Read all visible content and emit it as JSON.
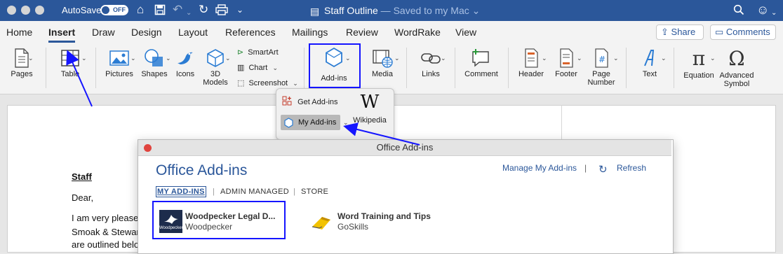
{
  "titlebar": {
    "autosave_label": "AutoSave",
    "autosave_state": "OFF",
    "document_name": "Staff Outline",
    "save_status": " — Saved to my Mac ⌄"
  },
  "tabs": [
    "Home",
    "Insert",
    "Draw",
    "Design",
    "Layout",
    "References",
    "Mailings",
    "Review",
    "WordRake",
    "View"
  ],
  "active_tab": "Insert",
  "share_label": "Share",
  "comments_label": "Comments",
  "ribbon": {
    "pages": "Pages",
    "table": "Table",
    "pictures": "Pictures",
    "shapes": "Shapes",
    "icons": "Icons",
    "models_line1": "3D",
    "models_line2": "Models",
    "smartart": "SmartArt",
    "chart": "Chart",
    "screenshot": "Screenshot",
    "addins": "Add-ins",
    "media": "Media",
    "links": "Links",
    "comment": "Comment",
    "header": "Header",
    "footer": "Footer",
    "page_number_line1": "Page",
    "page_number_line2": "Number",
    "text": "Text",
    "equation": "Equation",
    "advanced_line1": "Advanced",
    "advanced_line2": "Symbol"
  },
  "addins_menu": {
    "get_addins": "Get Add-ins",
    "my_addins": "My Add-ins",
    "wikipedia": "Wikipedia",
    "wikipedia_logo": "W"
  },
  "document": {
    "heading": "Staff",
    "salutation": "Dear,",
    "line1": "I am very please",
    "line2": "Smoak & Stewar",
    "line3": "are outlined belo"
  },
  "dialog": {
    "window_title": "Office Add-ins",
    "heading": "Office Add-ins",
    "manage_link": "Manage My Add-ins",
    "separator": "|",
    "refresh": "Refresh",
    "filters": [
      "MY ADD-INS",
      "ADMIN MANAGED",
      "STORE"
    ],
    "addins": [
      {
        "name": "Woodpecker Legal D...",
        "publisher": "Woodpecker",
        "logo_text": "Woodpecker"
      },
      {
        "name": "Word Training and Tips",
        "publisher": "GoSkills"
      }
    ]
  },
  "colors": {
    "brand": "#2b579a",
    "annotation": "#1515ff"
  }
}
